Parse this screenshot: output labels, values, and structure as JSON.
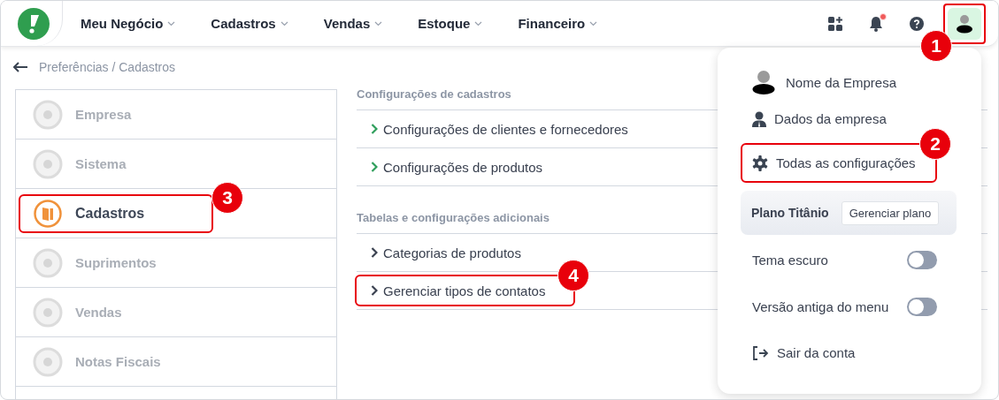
{
  "nav": {
    "items": [
      {
        "label": "Meu Negócio"
      },
      {
        "label": "Cadastros"
      },
      {
        "label": "Vendas"
      },
      {
        "label": "Estoque"
      },
      {
        "label": "Financeiro"
      }
    ],
    "notification_dot": true,
    "avatar_callout": "1"
  },
  "breadcrumb": "Preferências / Cadastros",
  "sidebar": {
    "items": [
      {
        "label": "Empresa",
        "selected": false
      },
      {
        "label": "Sistema",
        "selected": false
      },
      {
        "label": "Cadastros",
        "selected": true,
        "callout": "3"
      },
      {
        "label": "Suprimentos",
        "selected": false
      },
      {
        "label": "Vendas",
        "selected": false
      },
      {
        "label": "Notas Fiscais",
        "selected": false
      }
    ]
  },
  "sections": [
    {
      "title": "Configurações de cadastros",
      "links": [
        {
          "label": "Configurações de clientes e fornecedores",
          "color": "#2e9e5b"
        },
        {
          "label": "Configurações de produtos",
          "color": "#2e9e5b"
        }
      ]
    },
    {
      "title": "Tabelas e configurações adicionais",
      "links": [
        {
          "label": "Categorias de produtos",
          "color": "#3a4150"
        },
        {
          "label": "Gerenciar tipos de contatos",
          "color": "#3a4150",
          "callout": "4"
        }
      ]
    }
  ],
  "user_menu": {
    "company": "Nome da Empresa",
    "items": [
      {
        "kind": "profile",
        "label": "Dados da empresa"
      },
      {
        "kind": "settings",
        "label": "Todas as configurações",
        "callout": "2"
      },
      {
        "kind": "plan",
        "label": "Plano Titânio",
        "button": "Gerenciar plano"
      },
      {
        "kind": "toggle",
        "label": "Tema escuro",
        "on": false
      },
      {
        "kind": "toggle",
        "label": "Versão antiga do menu",
        "on": false
      },
      {
        "kind": "logout",
        "label": "Sair da conta"
      }
    ]
  }
}
